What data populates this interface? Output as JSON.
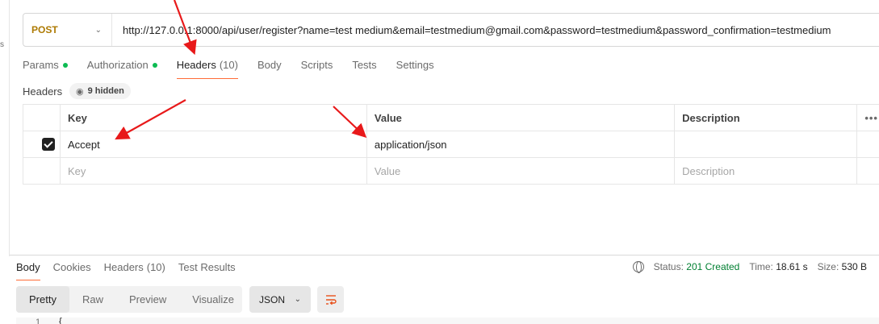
{
  "left_strip": {
    "char": "s"
  },
  "request": {
    "method": "POST",
    "url": "http://127.0.0.1:8000/api/user/register?name=test medium&email=testmedium@gmail.com&password=testmedium&password_confirmation=testmedium"
  },
  "request_tabs": [
    {
      "label": "Params",
      "dot": true
    },
    {
      "label": "Authorization",
      "dot": true
    },
    {
      "label": "Headers",
      "count": "(10)",
      "active": true
    },
    {
      "label": "Body"
    },
    {
      "label": "Scripts"
    },
    {
      "label": "Tests"
    },
    {
      "label": "Settings"
    }
  ],
  "headers_section": {
    "label": "Headers",
    "hidden_count": "9 hidden",
    "columns": [
      "Key",
      "Value",
      "Description"
    ],
    "rows": [
      {
        "checked": true,
        "key": "Accept",
        "value": "application/json",
        "description": ""
      }
    ],
    "placeholder": {
      "key": "Key",
      "value": "Value",
      "description": "Description"
    },
    "more": "•••"
  },
  "response": {
    "tabs": [
      {
        "label": "Body",
        "active": true
      },
      {
        "label": "Cookies"
      },
      {
        "label": "Headers",
        "count": "(10)"
      },
      {
        "label": "Test Results"
      }
    ],
    "status_label": "Status:",
    "status_value": "201 Created",
    "time_label": "Time:",
    "time_value": "18.61 s",
    "size_label": "Size:",
    "size_value": "530 B",
    "view_tabs": [
      "Pretty",
      "Raw",
      "Preview",
      "Visualize"
    ],
    "format": "JSON",
    "line_number": "1",
    "first_char": "{"
  },
  "colors": {
    "method": "#ad7a03",
    "tab_underline": "#ff6c37",
    "dot": "#0cbb52",
    "status_ok": "#007f31",
    "arrow": "#e8191a"
  }
}
